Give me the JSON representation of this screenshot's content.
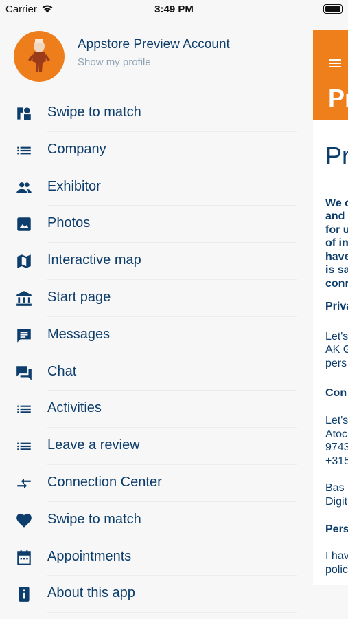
{
  "status_bar": {
    "carrier": "Carrier",
    "time": "3:49 PM"
  },
  "profile": {
    "name": "Appstore Preview Account",
    "link": "Show my profile"
  },
  "menu": [
    {
      "label": "Swipe to match",
      "icon": "swipe-cards-icon"
    },
    {
      "label": "Company",
      "icon": "list-icon"
    },
    {
      "label": "Exhibitor",
      "icon": "people-icon"
    },
    {
      "label": "Photos",
      "icon": "photo-icon"
    },
    {
      "label": "Interactive map",
      "icon": "map-icon"
    },
    {
      "label": "Start page",
      "icon": "bank-icon"
    },
    {
      "label": "Messages",
      "icon": "message-icon"
    },
    {
      "label": "Chat",
      "icon": "chat-icon"
    },
    {
      "label": "Activities",
      "icon": "list-icon"
    },
    {
      "label": "Leave a review",
      "icon": "list-icon"
    },
    {
      "label": "Connection Center",
      "icon": "compare-arrows-icon"
    },
    {
      "label": "Swipe to match",
      "icon": "heart-icon"
    },
    {
      "label": "Appointments",
      "icon": "calendar-icon"
    },
    {
      "label": "About this app",
      "icon": "info-icon"
    }
  ],
  "background_page": {
    "header_title": "Pr",
    "body_title": "Pr",
    "lines": [
      {
        "text": "We c",
        "bold": true
      },
      {
        "text": "and",
        "bold": true
      },
      {
        "text": "for u",
        "bold": true
      },
      {
        "text": "of in",
        "bold": true
      },
      {
        "text": "have",
        "bold": true
      },
      {
        "text": "is sa",
        "bold": true
      },
      {
        "text": "conr",
        "bold": true
      },
      {
        "text": "Priva",
        "bold": true
      },
      {
        "text": "Let's",
        "bold": false
      },
      {
        "text": "AK G",
        "bold": false
      },
      {
        "text": "pers",
        "bold": false
      },
      {
        "text": "Con",
        "bold": true
      },
      {
        "text": "Let's",
        "bold": false
      },
      {
        "text": "Atoc",
        "bold": false
      },
      {
        "text": "9743",
        "bold": false
      },
      {
        "text": "+315",
        "bold": false
      },
      {
        "text": "Bas",
        "bold": false
      },
      {
        "text": "Digit",
        "bold": false
      },
      {
        "text": "Pers",
        "bold": true
      },
      {
        "text": "I hav",
        "bold": false
      },
      {
        "text": "polic",
        "bold": false
      }
    ]
  },
  "colors": {
    "accent": "#ef7f1a",
    "text": "#0d3d6b",
    "muted": "#8fa3b5"
  }
}
